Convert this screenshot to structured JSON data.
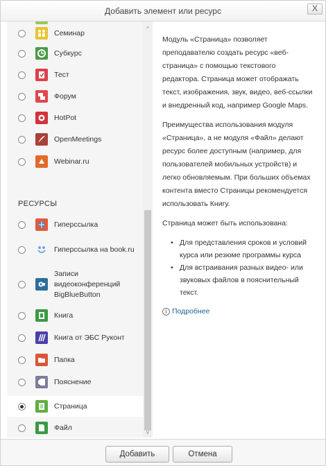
{
  "dialog": {
    "title": "Добавить элемент или ресурс",
    "close_label": "X"
  },
  "list": {
    "section_resources": "РЕСУРСЫ",
    "items": [
      {
        "label": "Семинар",
        "icon": "seminar-icon",
        "color": "#e8c430",
        "selected": false
      },
      {
        "label": "Субкурс",
        "icon": "subcourse-icon",
        "color": "#4a9a45",
        "selected": false
      },
      {
        "label": "Тест",
        "icon": "quiz-icon",
        "color": "#d9414b",
        "selected": false
      },
      {
        "label": "Форум",
        "icon": "forum-icon",
        "color": "#e0474c",
        "selected": false
      },
      {
        "label": "HotPot",
        "icon": "hotpot-icon",
        "color": "#d2323a",
        "selected": false
      },
      {
        "label": "OpenMeetings",
        "icon": "openmeetings-icon",
        "color": "#a8413a",
        "selected": false
      },
      {
        "label": "Webinar.ru",
        "icon": "webinar-icon",
        "color": "#e36a2a",
        "selected": false
      },
      {
        "label": "Гиперссылка",
        "icon": "url-icon",
        "color": "#e05a3c",
        "selected": false
      },
      {
        "label": "Гиперссылка на book.ru",
        "icon": "book-ru-icon",
        "color": "#6fa8dc",
        "selected": false
      },
      {
        "label": "Записи видеоконференций BigBlueButton",
        "icon": "bigbluebutton-icon",
        "color": "#2d6e9a",
        "selected": false
      },
      {
        "label": "Книга",
        "icon": "book-icon",
        "color": "#3a9a44",
        "selected": false
      },
      {
        "label": "Книга от ЭБС Руконт",
        "icon": "rucont-icon",
        "color": "#4b3fa8",
        "selected": false
      },
      {
        "label": "Папка",
        "icon": "folder-icon",
        "color": "#d8563a",
        "selected": false
      },
      {
        "label": "Пояснение",
        "icon": "label-icon",
        "color": "#7d7d9a",
        "selected": false
      },
      {
        "label": "Страница",
        "icon": "page-icon",
        "color": "#5fae3f",
        "selected": true
      },
      {
        "label": "Файл",
        "icon": "file-icon",
        "color": "#3a9a44",
        "selected": false
      }
    ]
  },
  "description": {
    "p1": "Модуль «Страница» позволяет преподавателю создать ресурс «веб-страница» с помощью текстового редактора. Страница может отображать текст, изображения, звук, видео, веб-ссылки и внедренный код, например Google Maps.",
    "p2": "Преимущества использования модуля «Страница», а не модуля «Файл» делают ресурс более доступным (например, для пользователей мобильных устройств) и легко обновляемым. При больших объемах контента вместо Страницы рекомендуется использовать Книгу.",
    "p3": "Страница может быть использована:",
    "bullets": [
      "Для представления сроков и условий курса или резюме программы курса",
      "Для встраивания разных видео- или звуковых файлов в пояснительный текст."
    ],
    "more_link": "Подробнее",
    "more_icon": "info-icon"
  },
  "footer": {
    "add_label": "Добавить",
    "cancel_label": "Отмена"
  }
}
